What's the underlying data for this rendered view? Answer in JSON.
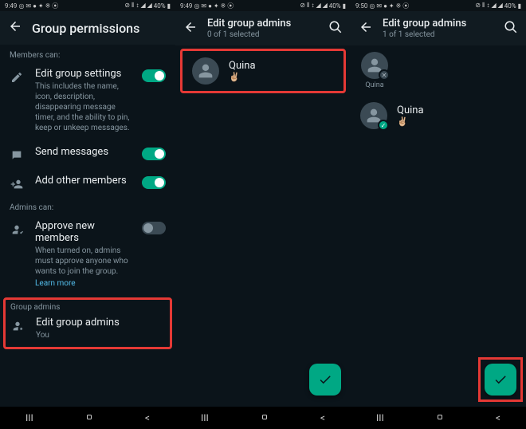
{
  "status": {
    "time1": "9:49",
    "time2": "9:49",
    "time3": "9:50",
    "icons_left": "◎ ✉ ● ✦ ※ ⦿",
    "icons_right": "⊘ ⫴ ↕ ◢ ◢",
    "battery": "40%"
  },
  "screen1": {
    "title": "Group permissions",
    "members_can": "Members can:",
    "edit_settings_title": "Edit group settings",
    "edit_settings_desc": "This includes the name, icon, description, disappearing message timer, and the ability to pin, keep or unkeep messages.",
    "send_messages": "Send messages",
    "add_members": "Add other members",
    "admins_can": "Admins can:",
    "approve_title": "Approve new members",
    "approve_desc": "When turned on, admins must approve anyone who wants to join the group.",
    "learn_more": "Learn more",
    "group_admins": "Group admins",
    "edit_admins": "Edit group admins",
    "you": "You"
  },
  "screen2": {
    "title": "Edit group admins",
    "sub": "0 of 1 selected",
    "contact_name": "Quina",
    "contact_status": "✌🏼"
  },
  "screen3": {
    "title": "Edit group admins",
    "sub": "1 of 1 selected",
    "sel_name": "Quina",
    "contact_name": "Quina",
    "contact_status": "✌🏼"
  }
}
